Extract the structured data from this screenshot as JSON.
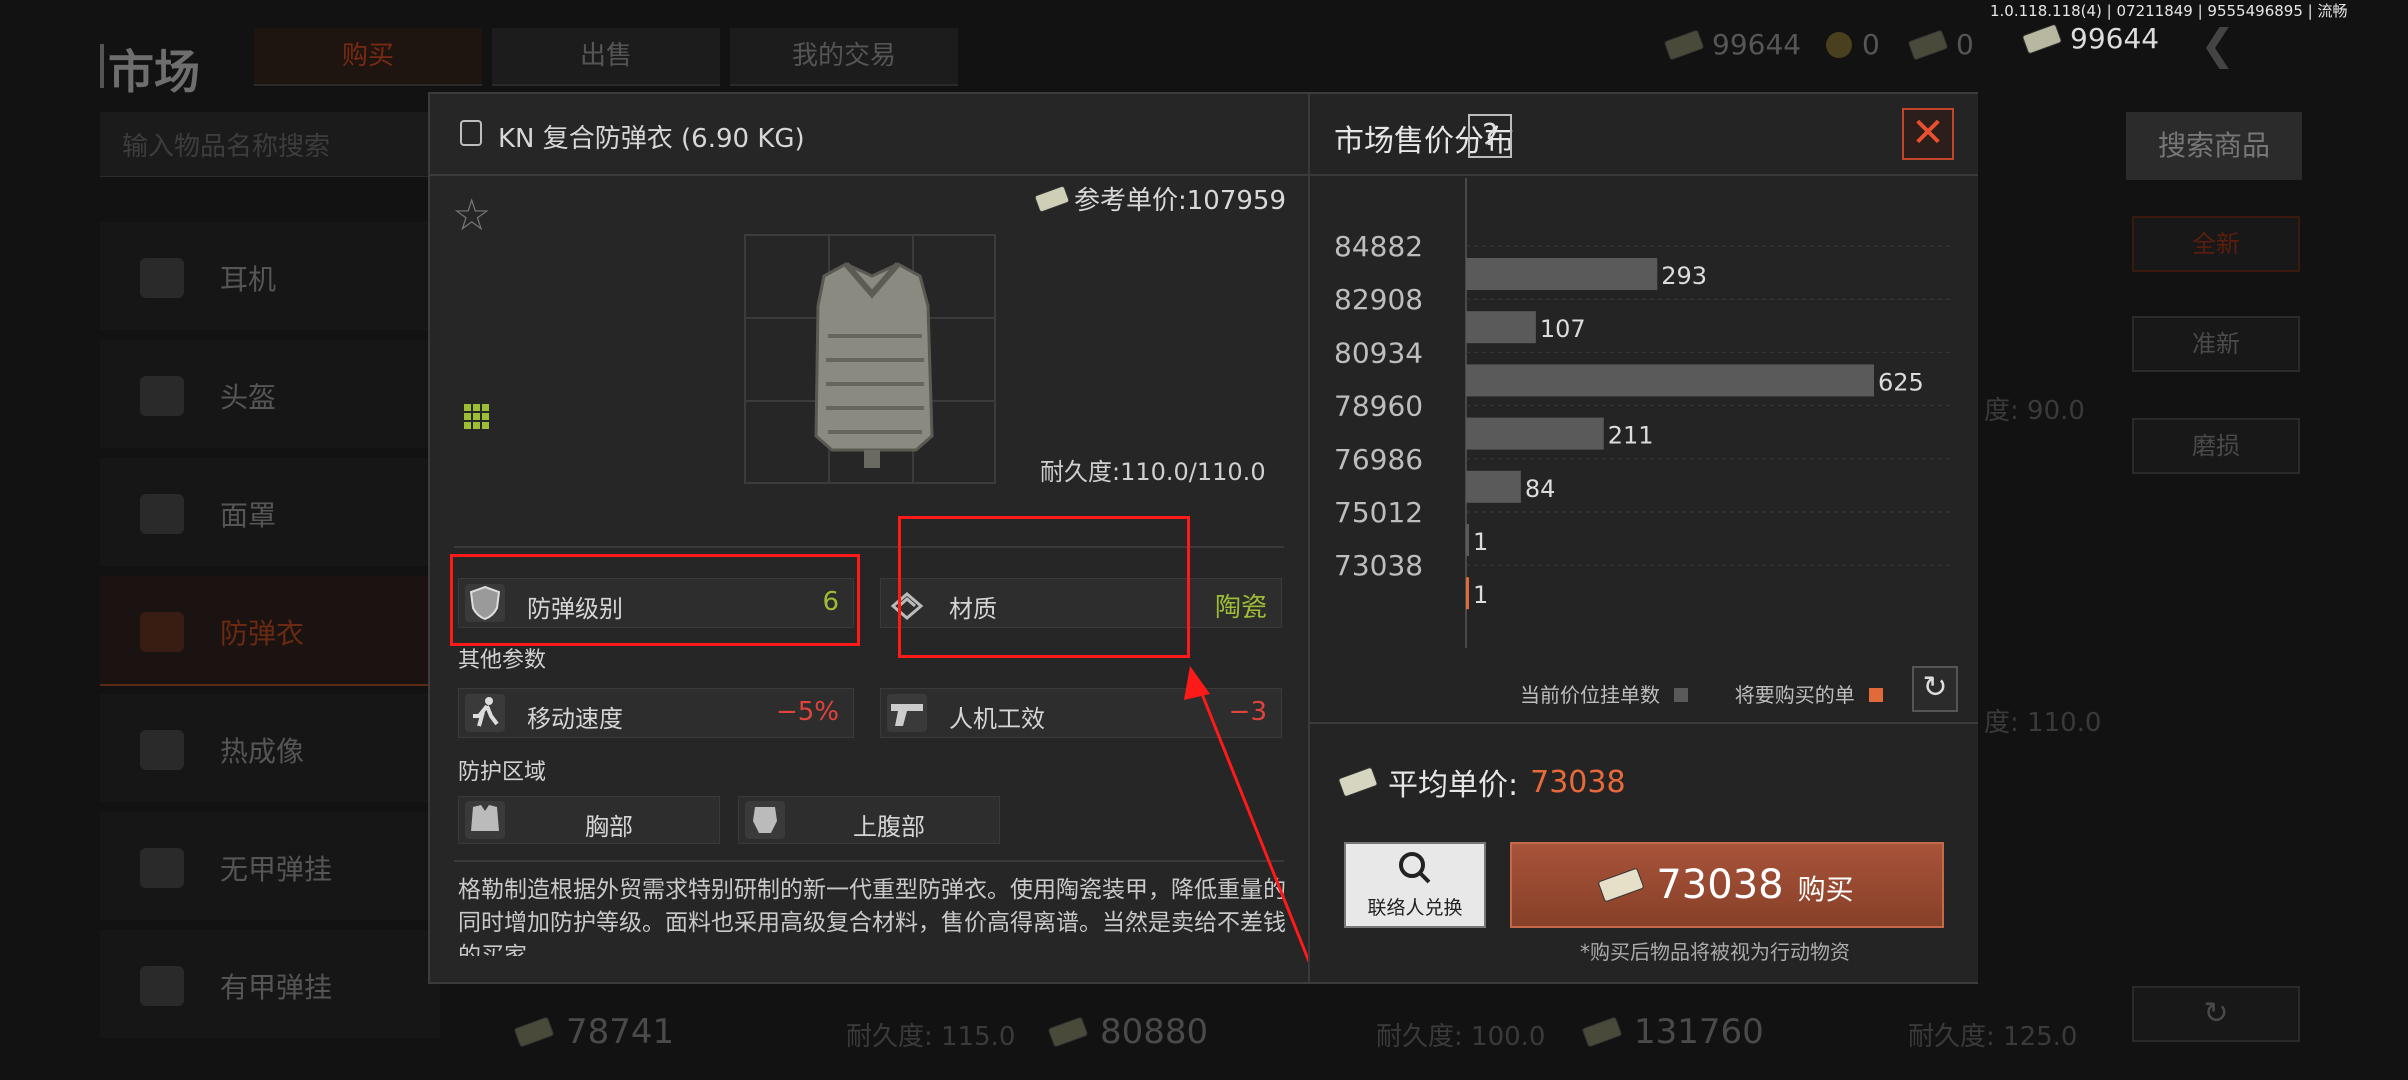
{
  "build_info": "1.0.118.118(4) | 07211849 | 9555496895 | 流畅",
  "background": {
    "title": "市场",
    "tabs": [
      {
        "label": "购买",
        "active": true
      },
      {
        "label": "出售",
        "active": false
      },
      {
        "label": "我的交易",
        "active": false
      }
    ],
    "currencies": [
      {
        "icon": "cash-icon",
        "value": "99644"
      },
      {
        "icon": "coin-icon",
        "value": "0"
      },
      {
        "icon": "bond-icon",
        "value": "0"
      },
      {
        "icon": "cash-icon",
        "value": "99644"
      }
    ],
    "search_placeholder": "输入物品名称搜索",
    "search_button": "搜索商品",
    "sidebar": [
      {
        "label": "耳机",
        "icon": "headset-icon"
      },
      {
        "label": "头盔",
        "icon": "helmet-icon"
      },
      {
        "label": "面罩",
        "icon": "mask-icon"
      },
      {
        "label": "防弹衣",
        "icon": "armor-icon",
        "active": true
      },
      {
        "label": "热成像",
        "icon": "thermal-icon"
      },
      {
        "label": "无甲弹挂",
        "icon": "rig-icon"
      },
      {
        "label": "有甲弹挂",
        "icon": "armored-rig-icon"
      }
    ],
    "filters": [
      {
        "label": "全新",
        "active": true
      },
      {
        "label": "准新",
        "active": false
      },
      {
        "label": "磨损",
        "active": false
      }
    ],
    "side_dura": [
      "度: 90.0",
      "度: 110.0"
    ],
    "listings": [
      {
        "price": "78741",
        "durability": "耐久度: 115.0"
      },
      {
        "price": "80880",
        "durability": "耐久度: 100.0"
      },
      {
        "price": "131760",
        "durability": "耐久度: 125.0"
      }
    ]
  },
  "item": {
    "title": "KN 复合防弹衣 (6.90 KG)",
    "ref_price": "参考单价:107959",
    "durability": "耐久度:110.0/110.0",
    "stats": {
      "armor_level_label": "防弹级别",
      "armor_level_value": "6",
      "material_label": "材质",
      "material_value": "陶瓷"
    },
    "other_params_title": "其他参数",
    "other_params": [
      {
        "label": "移动速度",
        "value": "−5%"
      },
      {
        "label": "人机工效",
        "value": "−3"
      }
    ],
    "protection_title": "防护区域",
    "protection_zones": [
      "胸部",
      "上腹部"
    ],
    "description": "格勒制造根据外贸需求特别研制的新一代重型防弹衣。使用陶瓷装甲，降低重量的同时增加防护等级。面料也采用高级复合材料，售价高得离谱。当然是卖给不差钱的买家。"
  },
  "market": {
    "title": "市场售价分布",
    "help": "?",
    "close": "✕",
    "legend_current": "当前价位挂单数",
    "legend_buy": "将要购买的单",
    "avg_label": "平均单价:",
    "avg_value": "73038",
    "contact_label": "联络人兑换",
    "buy_price": "73038",
    "buy_label": "购买",
    "note": "*购买后物品将被视为行动物资",
    "colors": {
      "bar": "#5a5a5a",
      "buy_bar": "#e06a3a",
      "accent": "#e86a3a"
    }
  },
  "chart_data": {
    "type": "bar",
    "orientation": "horizontal",
    "categories": [
      "84882",
      "82908",
      "80934",
      "78960",
      "76986",
      "75012",
      "73038"
    ],
    "values": [
      293,
      107,
      625,
      211,
      84,
      1,
      1
    ],
    "highlight_category": "73038",
    "grid": true
  }
}
